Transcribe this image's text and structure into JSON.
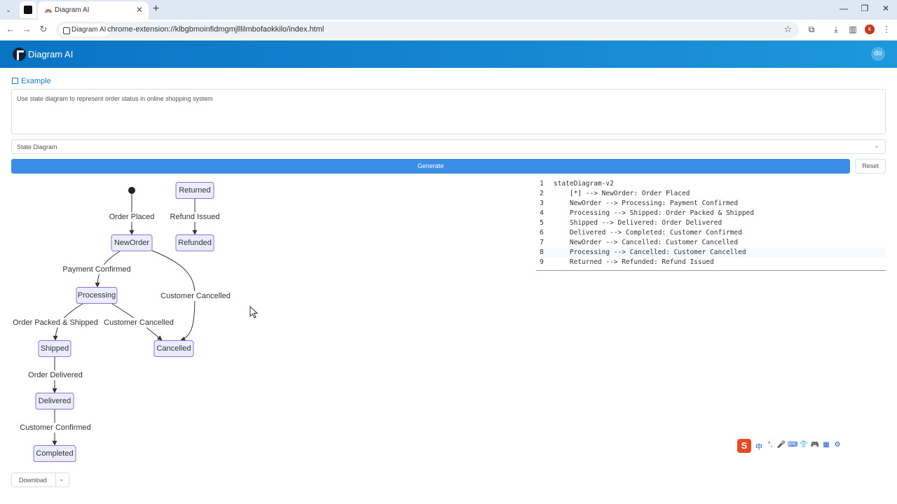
{
  "browser": {
    "tab_title": "Diagram AI",
    "url": "chrome-extension://klbgbmoinfidmgmjlllilmbofaokkilo/index.html",
    "site_chip": "Diagram AI",
    "profile_initial": "k"
  },
  "app": {
    "title": "Diagram AI",
    "avatar": "do",
    "example_label": "Example",
    "prompt_text": "Use state diagram to represent order status in online shopping system",
    "diagram_type": "State Diagram",
    "generate_label": "Generate",
    "reset_label": "Reset",
    "download_label": "Download"
  },
  "diagram": {
    "states": [
      "NewOrder",
      "Processing",
      "Shipped",
      "Delivered",
      "Completed",
      "Cancelled",
      "Returned",
      "Refunded"
    ],
    "transitions": [
      {
        "from": "[*]",
        "to": "NewOrder",
        "label": "Order Placed"
      },
      {
        "from": "NewOrder",
        "to": "Processing",
        "label": "Payment Confirmed"
      },
      {
        "from": "Processing",
        "to": "Shipped",
        "label": "Order Packed & Shipped"
      },
      {
        "from": "Shipped",
        "to": "Delivered",
        "label": "Order Delivered"
      },
      {
        "from": "Delivered",
        "to": "Completed",
        "label": "Customer Confirmed"
      },
      {
        "from": "NewOrder",
        "to": "Cancelled",
        "label": "Customer Cancelled"
      },
      {
        "from": "Processing",
        "to": "Cancelled",
        "label": "Customer Cancelled"
      },
      {
        "from": "Returned",
        "to": "Refunded",
        "label": "Refund Issued"
      }
    ]
  },
  "code": {
    "active_line": 8,
    "lines": [
      "stateDiagram-v2",
      "    [*] --> NewOrder: Order Placed",
      "    NewOrder --> Processing: Payment Confirmed",
      "    Processing --> Shipped: Order Packed & Shipped",
      "    Shipped --> Delivered: Order Delivered",
      "    Delivered --> Completed: Customer Confirmed",
      "    NewOrder --> Cancelled: Customer Cancelled",
      "    Processing --> Cancelled: Customer Cancelled",
      "    Returned --> Refunded: Refund Issued"
    ]
  },
  "ime": {
    "logo": "S",
    "items": [
      "中",
      "°,",
      "🎤",
      "⌨",
      "👕",
      "🎮",
      "▦",
      "⚙"
    ]
  }
}
